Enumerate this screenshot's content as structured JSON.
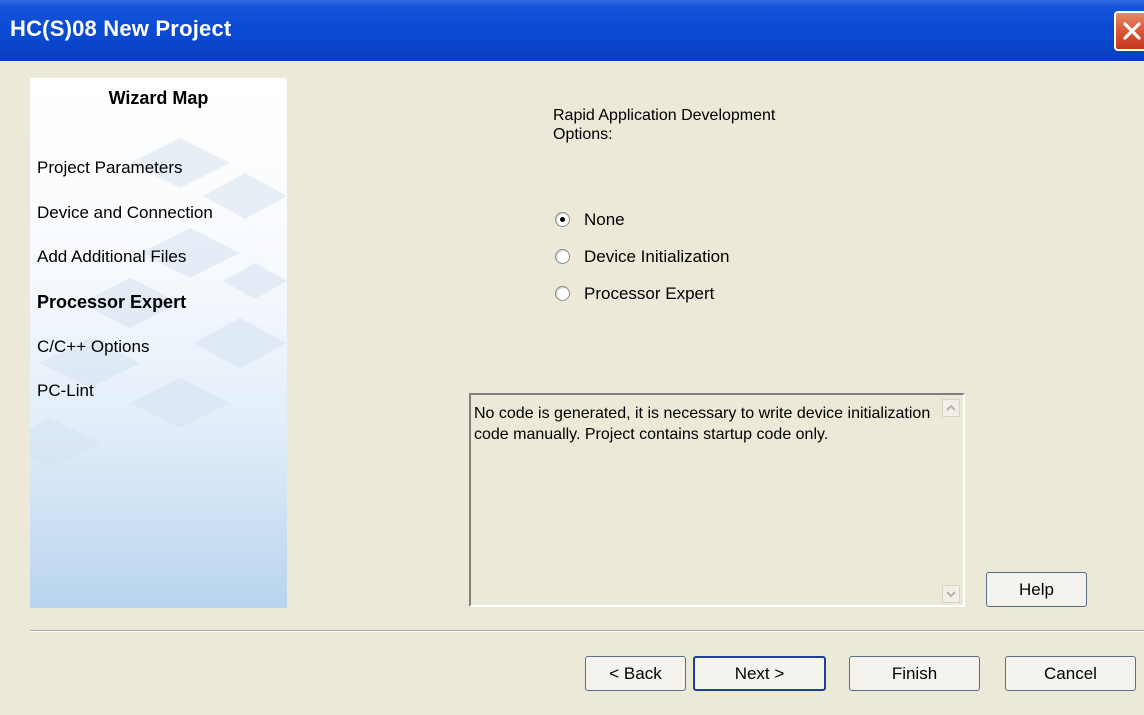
{
  "window": {
    "title": "HC(S)08 New Project"
  },
  "wizard_map": {
    "title": "Wizard Map",
    "items": [
      {
        "label": "Project Parameters",
        "active": false
      },
      {
        "label": "Device and Connection",
        "active": false
      },
      {
        "label": "Add Additional Files",
        "active": false
      },
      {
        "label": "Processor Expert",
        "active": true
      },
      {
        "label": "C/C++ Options",
        "active": false
      },
      {
        "label": "PC-Lint",
        "active": false
      }
    ]
  },
  "rad_options": {
    "heading": "Rapid Application Development\nOptions:",
    "options": [
      {
        "label": "None",
        "selected": true
      },
      {
        "label": "Device Initialization",
        "selected": false
      },
      {
        "label": "Processor Expert",
        "selected": false
      }
    ],
    "description": "No code is generated, it is necessary to write device initialization code manually. Project contains startup code only."
  },
  "buttons": {
    "help": "Help",
    "back": "< Back",
    "next": "Next >",
    "finish": "Finish",
    "cancel": "Cancel"
  },
  "colors": {
    "title_bar": "#0b4bd5",
    "dialog_bg": "#ece9d8",
    "close_button": "#d9553a"
  }
}
